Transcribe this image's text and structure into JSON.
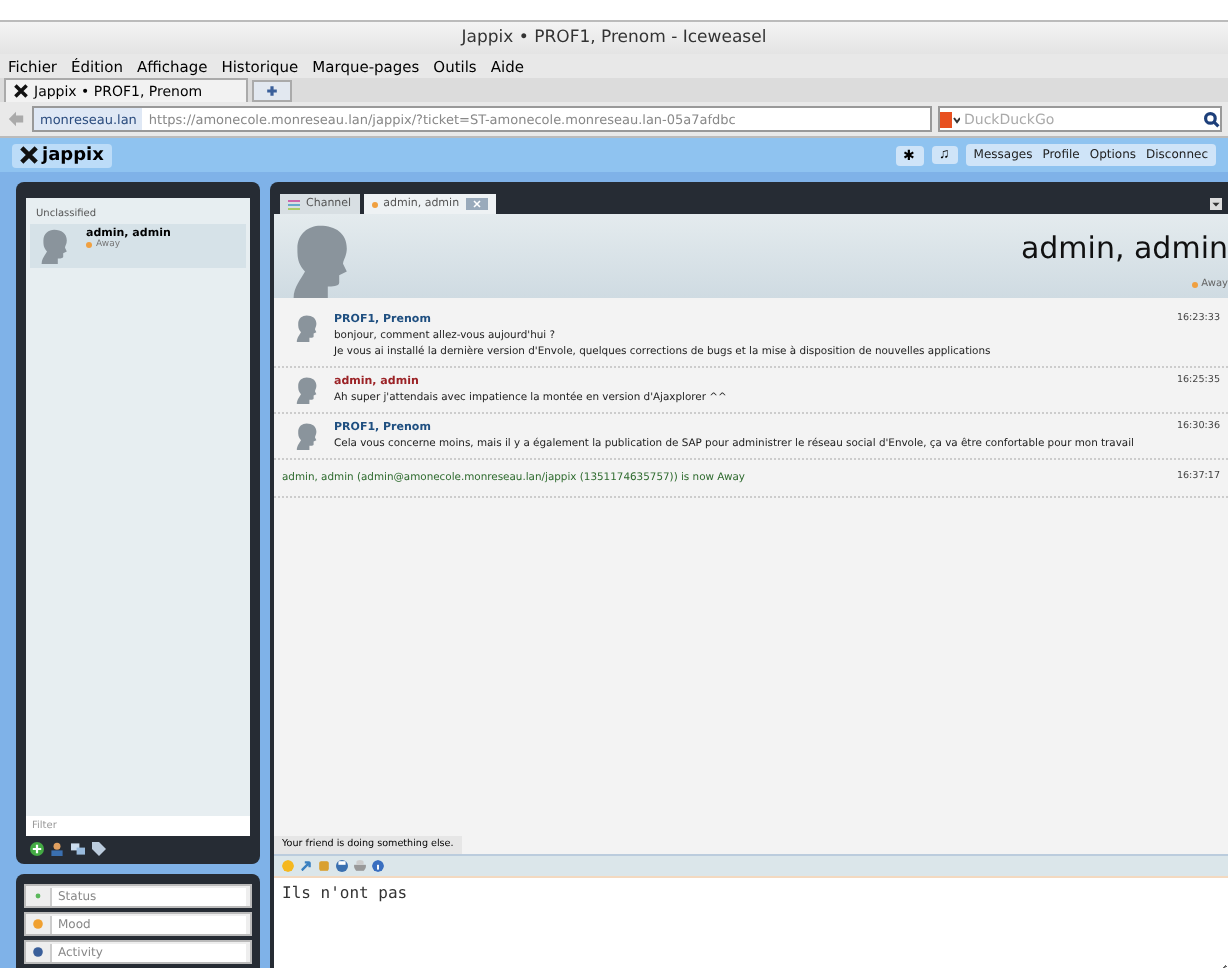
{
  "window": {
    "title": "Jappix • PROF1, Prenom - Iceweasel"
  },
  "menu_bar": [
    "Fichier",
    "Édition",
    "Affichage",
    "Historique",
    "Marque-pages",
    "Outils",
    "Aide"
  ],
  "browser_tab": {
    "title": "Jappix • PROF1, Prenom"
  },
  "url_bar": {
    "site": "monreseau.lan",
    "url": "https://amonecole.monreseau.lan/jappix/?ticket=ST-amonecole.monreseau.lan-05a7afdbc"
  },
  "search_field": {
    "placeholder": "DuckDuckGo"
  },
  "app_bar": {
    "logo": "jappix",
    "icon_buttons": [
      "✱",
      "♫"
    ],
    "links": [
      "Messages",
      "Profile",
      "Options",
      "Disconnec"
    ]
  },
  "roster": {
    "group": "Unclassified",
    "contacts": [
      {
        "name": "admin, admin",
        "status": "Away",
        "selected": true
      }
    ],
    "filter": {
      "placeholder": "Filter"
    }
  },
  "presence": [
    {
      "kind": "status",
      "placeholder": "Status"
    },
    {
      "kind": "mood",
      "placeholder": "Mood"
    },
    {
      "kind": "activity",
      "placeholder": "Activity"
    }
  ],
  "chat_tabs": [
    {
      "label": "Channel",
      "selected": false
    },
    {
      "label": "admin, admin",
      "selected": true
    }
  ],
  "chat_header": {
    "name": "admin, admin",
    "status": "Away"
  },
  "messages": [
    {
      "kind": "message",
      "author": "PROF1, Prenom",
      "color": "#1f4f80",
      "time": "16:23:33",
      "lines": [
        "bonjour, comment allez-vous aujourd'hui ?",
        "Je vous ai installé la dernière version d'Envole, quelques corrections de bugs et la mise à disposition de nouvelles applications"
      ]
    },
    {
      "kind": "message",
      "author": "admin, admin",
      "color": "#9b2226",
      "time": "16:25:35",
      "lines": [
        "Ah super j'attendais avec impatience la montée en version d'Ajaxplorer ^^"
      ]
    },
    {
      "kind": "message",
      "author": "PROF1, Prenom",
      "color": "#1f4f80",
      "time": "16:30:36",
      "lines": [
        "Cela vous concerne moins, mais il y a également la publication de SAP pour administrer le réseau social d'Envole, ça va être confortable pour mon travail"
      ]
    },
    {
      "kind": "system",
      "text": "admin, admin (admin@amonecole.monreseau.lan/jappix (1351174635757)) is now Away",
      "time": "16:37:17"
    }
  ],
  "typing_notice": "Your friend is doing something else.",
  "composer": {
    "value": "Ils n'ont pas "
  }
}
